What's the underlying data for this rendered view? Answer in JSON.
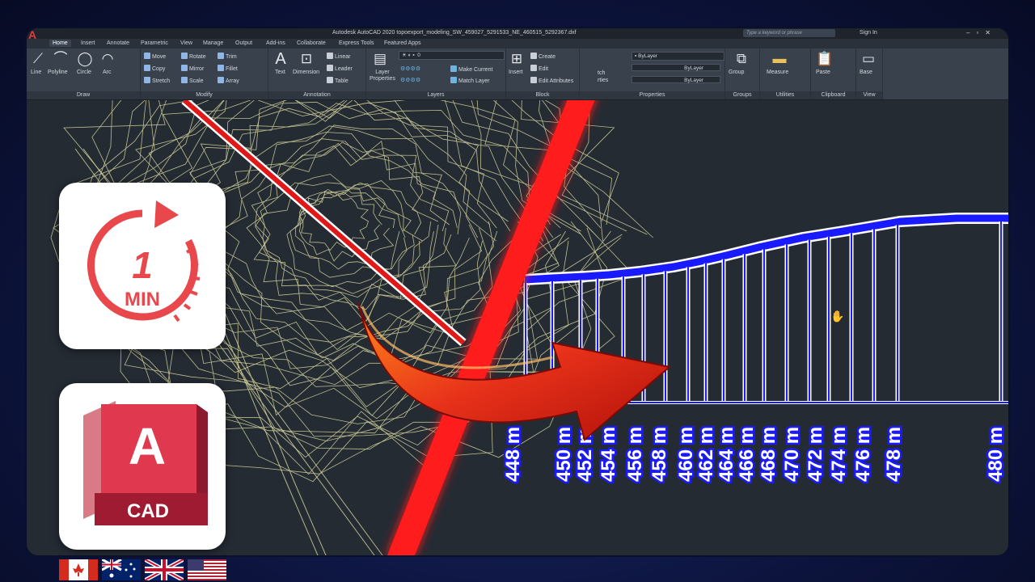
{
  "app": {
    "title": "Autodesk AutoCAD 2020    topoexport_modeling_SW_459027_5291533_NE_460515_5292367.dxf",
    "search_placeholder": "Type a keyword or phrase",
    "signin": "Sign In",
    "logo": "A"
  },
  "tabs": [
    "Home",
    "Insert",
    "Annotate",
    "Parametric",
    "View",
    "Manage",
    "Output",
    "Add-ins",
    "Collaborate",
    "Express Tools",
    "Featured Apps"
  ],
  "panels": {
    "draw": {
      "title": "Draw",
      "tools": [
        "Line",
        "Polyline",
        "Circle",
        "Arc"
      ]
    },
    "modify": {
      "title": "Modify",
      "tools": [
        "Move",
        "Rotate",
        "Trim",
        "Copy",
        "Mirror",
        "Fillet",
        "Stretch",
        "Scale",
        "Array"
      ]
    },
    "annotation": {
      "title": "Annotation",
      "tools": [
        "Text",
        "Dimension",
        "Linear",
        "Leader",
        "Table"
      ]
    },
    "layers": {
      "title": "Layers",
      "tools": [
        "Layer Properties",
        "Make Current",
        "Match Layer"
      ],
      "current_layer": "0"
    },
    "block": {
      "title": "Block",
      "tools": [
        "Insert",
        "Create",
        "Edit",
        "Edit Attributes"
      ]
    },
    "properties": {
      "title": "Properties",
      "color": "ByLayer",
      "linetype": "ByLayer",
      "lineweight": "ByLayer",
      "partial_label_1": "tch",
      "partial_label_2": "rties"
    },
    "groups": {
      "title": "Groups",
      "tools": [
        "Group"
      ]
    },
    "utilities": {
      "title": "Utilities",
      "tools": [
        "Measure"
      ]
    },
    "clipboard": {
      "title": "Clipboard",
      "tools": [
        "Paste"
      ]
    },
    "view": {
      "title": "View",
      "tools": [
        "Base"
      ]
    }
  },
  "elevation_labels": [
    "448 m",
    "450 m",
    "452 m",
    "454 m",
    "456 m",
    "458 m",
    "460 m",
    "462 m",
    "464 m",
    "466 m",
    "468 m",
    "470 m",
    "472 m",
    "474 m",
    "476 m",
    "478 m",
    "480 m"
  ],
  "badges": {
    "timer_number": "1",
    "timer_unit": "MIN",
    "cad_letter": "A",
    "cad_label": "CAD"
  },
  "flags": [
    "canada-flag",
    "australia-flag",
    "uk-flag",
    "usa-flag"
  ],
  "colors": {
    "accent_red": "#ff1a1a",
    "profile_blue": "#1a1aff",
    "contour": "#d8d8a0",
    "autocad_red": "#c8283f"
  }
}
